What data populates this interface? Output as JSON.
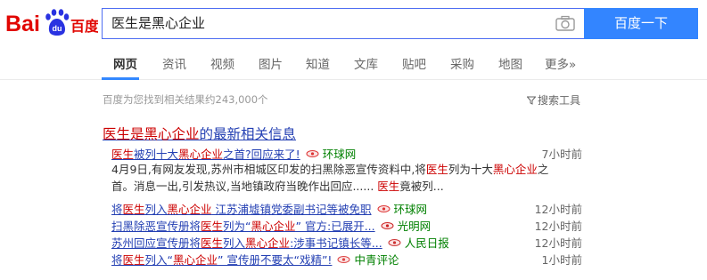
{
  "logo": {
    "text": "Bai百度"
  },
  "search": {
    "query": "医生是黑心企业",
    "button": "百度一下"
  },
  "tabs": [
    "网页",
    "资讯",
    "视频",
    "图片",
    "知道",
    "文库",
    "贴吧",
    "采购",
    "地图",
    "更多»"
  ],
  "results_stats": "百度为您找到相关结果约243,000个",
  "tools_label": "搜索工具",
  "news": {
    "title_hl": "医生是黑心企业",
    "title_rest": "的最新相关信息",
    "items": [
      {
        "parts": [
          {
            "t": "医生",
            "h": true
          },
          {
            "t": "被列十大",
            "h": false
          },
          {
            "t": "黑心企业",
            "h": true
          },
          {
            "t": "之首?回应来了!",
            "h": false
          }
        ],
        "source": "环球网",
        "time": "7小时前"
      },
      {
        "parts": [
          {
            "t": "将",
            "h": false
          },
          {
            "t": "医生",
            "h": true
          },
          {
            "t": "列入",
            "h": false
          },
          {
            "t": "黑心企业",
            "h": true
          },
          {
            "t": " 江苏浦墟镇党委副书记等被免职",
            "h": false
          }
        ],
        "source": "环球网",
        "time": "12小时前"
      },
      {
        "parts": [
          {
            "t": "扫黑除恶宣传册将",
            "h": false
          },
          {
            "t": "医生",
            "h": true
          },
          {
            "t": "列为“",
            "h": false
          },
          {
            "t": "黑心企业",
            "h": true
          },
          {
            "t": "” 官方:已展开...",
            "h": false
          }
        ],
        "source": "光明网",
        "time": "12小时前"
      },
      {
        "parts": [
          {
            "t": "苏州回应宣传册将",
            "h": false
          },
          {
            "t": "医生",
            "h": true
          },
          {
            "t": "列入",
            "h": false
          },
          {
            "t": "黑心企业",
            "h": true
          },
          {
            "t": ":涉事书记镇长等...",
            "h": false
          }
        ],
        "source": "人民日报",
        "time": "12小时前"
      },
      {
        "parts": [
          {
            "t": "将",
            "h": false
          },
          {
            "t": "医生",
            "h": true
          },
          {
            "t": "列入“",
            "h": false
          },
          {
            "t": "黑心企业",
            "h": true
          },
          {
            "t": "” 宣传册不要太“戏精”!",
            "h": false
          }
        ],
        "source": "中青评论",
        "time": "1小时前"
      }
    ],
    "abstract_line1": [
      {
        "t": "4月9日,有网友发现,苏州市相城区印发的扫黑除恶宣传资料中,将",
        "h": false
      },
      {
        "t": "医生",
        "h": true
      },
      {
        "t": "列为十大",
        "h": false
      },
      {
        "t": "黑心企业",
        "h": true
      },
      {
        "t": "之",
        "h": false
      }
    ],
    "abstract_line2": [
      {
        "t": "首。消息一出,引发热议,当地镇政府当晚作出回应...... ",
        "h": false
      },
      {
        "t": "医生",
        "h": true
      },
      {
        "t": "竟被列...",
        "h": false
      }
    ]
  },
  "colors": {
    "accent": "#3385ff",
    "link": "#2440b3",
    "highlight": "#c00",
    "source": "#008000"
  }
}
